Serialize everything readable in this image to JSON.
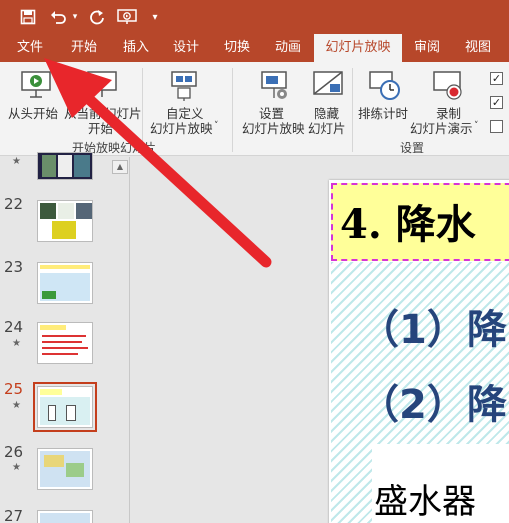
{
  "tabs": [
    "文件",
    "开始",
    "插入",
    "设计",
    "切换",
    "动画",
    "幻灯片放映",
    "审阅",
    "视图"
  ],
  "ribbon": {
    "from_start": "从头开始",
    "from_current_1": "从当前",
    "from_current_2": "幻灯片",
    "from_current_3": "开始",
    "custom_1": "自定义",
    "custom_2": "幻灯片放映",
    "group_start": "开始放映幻灯片",
    "setup_1": "设置",
    "setup_2": "幻灯片放映",
    "hide_1": "隐藏",
    "hide_2": "幻灯片",
    "rehearse": "排练计时",
    "record_1": "录制",
    "record_2": "幻灯片演示",
    "group_setup": "设置"
  },
  "slides": [
    {
      "num": "",
      "star": "★"
    },
    {
      "num": "22",
      "star": ""
    },
    {
      "num": "23",
      "star": ""
    },
    {
      "num": "24",
      "star": "★"
    },
    {
      "num": "25",
      "star": "★"
    },
    {
      "num": "26",
      "star": "★"
    },
    {
      "num": "27",
      "star": ""
    }
  ],
  "slide": {
    "title": "4. 降水",
    "item1": "（1）降",
    "item2": "（2）降",
    "container": "盛水器"
  },
  "colors": {
    "accent": "#b7472a",
    "selected_slide": "#c43e1c",
    "arrow": "#e8262b",
    "title_bg": "#ffff99",
    "title_border": "#d633d6",
    "body_text": "#26457c"
  }
}
